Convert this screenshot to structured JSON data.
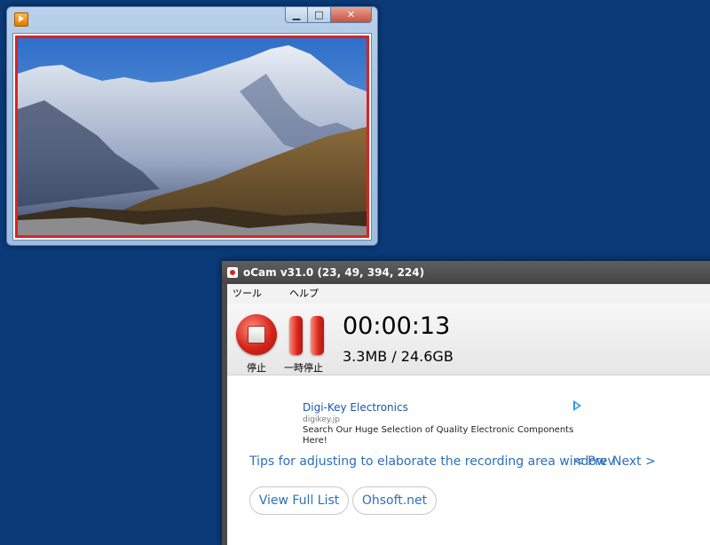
{
  "player": {
    "minimize_glyph": "▁",
    "maximize_glyph": "□",
    "close_glyph": "✕",
    "app_icon": "play-icon"
  },
  "ocam": {
    "title": "oCam v31.0 (23, 49, 394, 224)",
    "menu": [
      "ツール",
      "ヘルプ"
    ],
    "stop_label": "停止",
    "pause_label": "一時停止",
    "timer": "00:00:13",
    "size": "3.3MB / 24.6GB",
    "ad": {
      "title": "Digi-Key Electronics",
      "domain": "digikey.jp",
      "description": "Search Our Huge Selection of Quality Electronic Components Here!"
    },
    "tips": "Tips for adjusting to elaborate the recording area window",
    "prev": "< Prev",
    "next": "Next >",
    "view_full_list": "View Full List",
    "ohsoft": "Ohsoft.net",
    "colors": {
      "record_red": "#d3251a",
      "link_blue": "#2d6fb8",
      "area_border": "#e02020"
    }
  }
}
